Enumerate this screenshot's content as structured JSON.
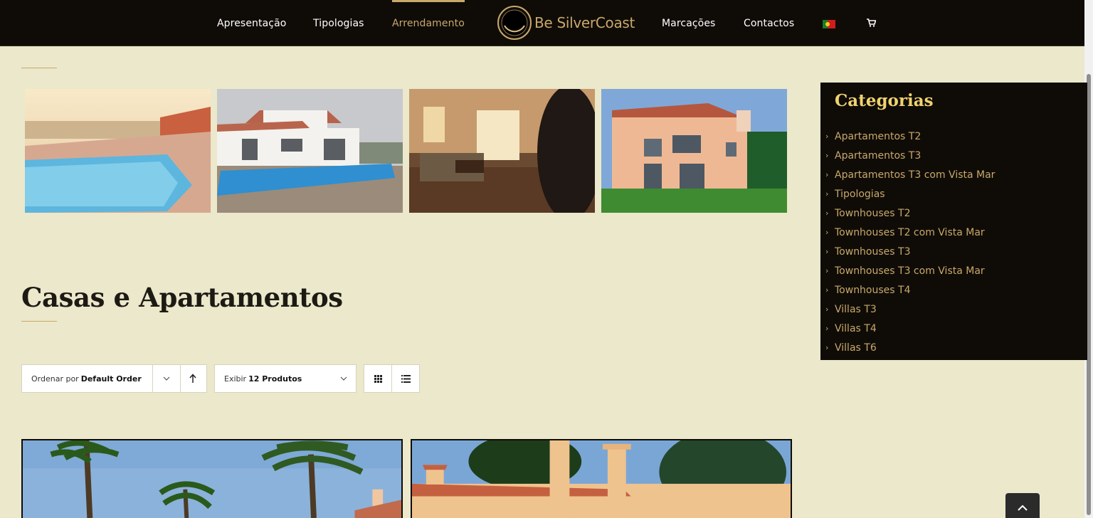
{
  "header": {
    "nav_left": [
      "Apresentação",
      "Tipologias",
      "Arrendamento"
    ],
    "nav_right": [
      "Marcações",
      "Contactos"
    ],
    "active_item": "Arrendamento",
    "logo_text": "Be SilverCoast",
    "language_flag": "portugal-flag-icon",
    "cart_icon": "cart-icon"
  },
  "main": {
    "section_title": "Casas e Apartamentos",
    "sort": {
      "prefix": "Ordenar por",
      "value": "Default Order"
    },
    "show": {
      "prefix": "Exibir",
      "value": "12 Produtos"
    },
    "gallery_alt": [
      "piscina com vista",
      "moradia com piscina",
      "sala de estar",
      "moradia fachada"
    ]
  },
  "sidebar": {
    "title": "Categorias",
    "items": [
      "Apartamentos T2",
      "Apartamentos T3",
      "Apartamentos T3 com Vista Mar",
      "Tipologias",
      "Townhouses T2",
      "Townhouses T2 com Vista Mar",
      "Townhouses T3",
      "Townhouses T3 com Vista Mar",
      "Townhouses T4",
      "Villas T3",
      "Villas T4",
      "Villas T6"
    ]
  },
  "colors": {
    "accent": "#c9a869",
    "header_bg": "#0f0c08",
    "page_bg": "#ebe8cb",
    "sidebar_title": "#f0d36f"
  }
}
